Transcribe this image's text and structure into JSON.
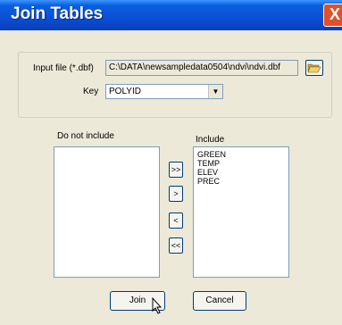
{
  "window": {
    "title": "Join Tables",
    "close_glyph": "X"
  },
  "input": {
    "label": "Input file (*.dbf)",
    "value": "C:\\DATA\\newsampledata0504\\ndvi\\ndvi.dbf",
    "browse_icon": "folder-open-icon"
  },
  "key": {
    "label": "Key",
    "value": "POLYID"
  },
  "lists": {
    "exclude_label": "Do not include",
    "include_label": "Include",
    "exclude_items": [],
    "include_items": [
      "GREEN",
      "TEMP",
      "ELEV",
      "PREC"
    ]
  },
  "move_buttons": {
    "add_all": ">>",
    "add": ">",
    "remove": "<",
    "remove_all": "<<"
  },
  "actions": {
    "join": "Join",
    "cancel": "Cancel"
  }
}
